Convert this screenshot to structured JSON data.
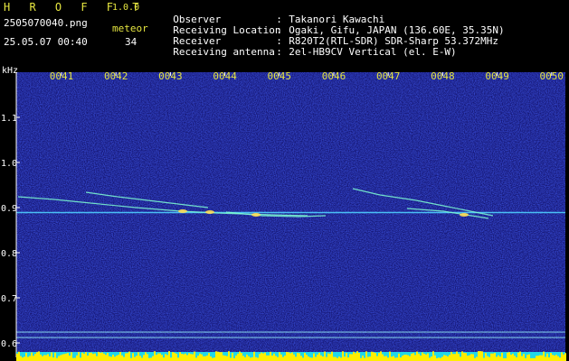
{
  "header": {
    "app_name": "H R O F F T",
    "version": "1.0.0",
    "filename": "2505070040.png",
    "meteor_label": "meteor",
    "datetime": "25.05.07 00:40",
    "meteor_count": "34"
  },
  "meta": [
    {
      "key": "Observer",
      "value": "Takanori Kawachi"
    },
    {
      "key": "Receiving Location",
      "value": "Ogaki, Gifu, JAPAN (136.60E, 35.35N)"
    },
    {
      "key": "Receiver",
      "value": "R820T2(RTL-SDR) SDR-Sharp 53.372MHz"
    },
    {
      "key": "Receiving antenna",
      "value": "2el-HB9CV Vertical (el. E-W)"
    }
  ],
  "axis": {
    "unit": "kHz",
    "time_labels": [
      "0041",
      "0042",
      "0043",
      "0044",
      "0045",
      "0046",
      "0047",
      "0048",
      "0049",
      "0050"
    ],
    "freq_labels": [
      "1.1",
      "1.0",
      "0.9",
      "0.8",
      "0.7",
      "0.6"
    ],
    "freq_values": [
      1.1,
      1.0,
      0.9,
      0.8,
      0.7,
      0.6
    ]
  },
  "colors": {
    "background_noise": "#1a1a8c",
    "carrier": "#4fd0ff",
    "meteor_trail": "#7fffd4",
    "reference_line": "#a0ffff",
    "bottom_bar": "#ffee00",
    "header_yellow": "#e6e640"
  }
}
